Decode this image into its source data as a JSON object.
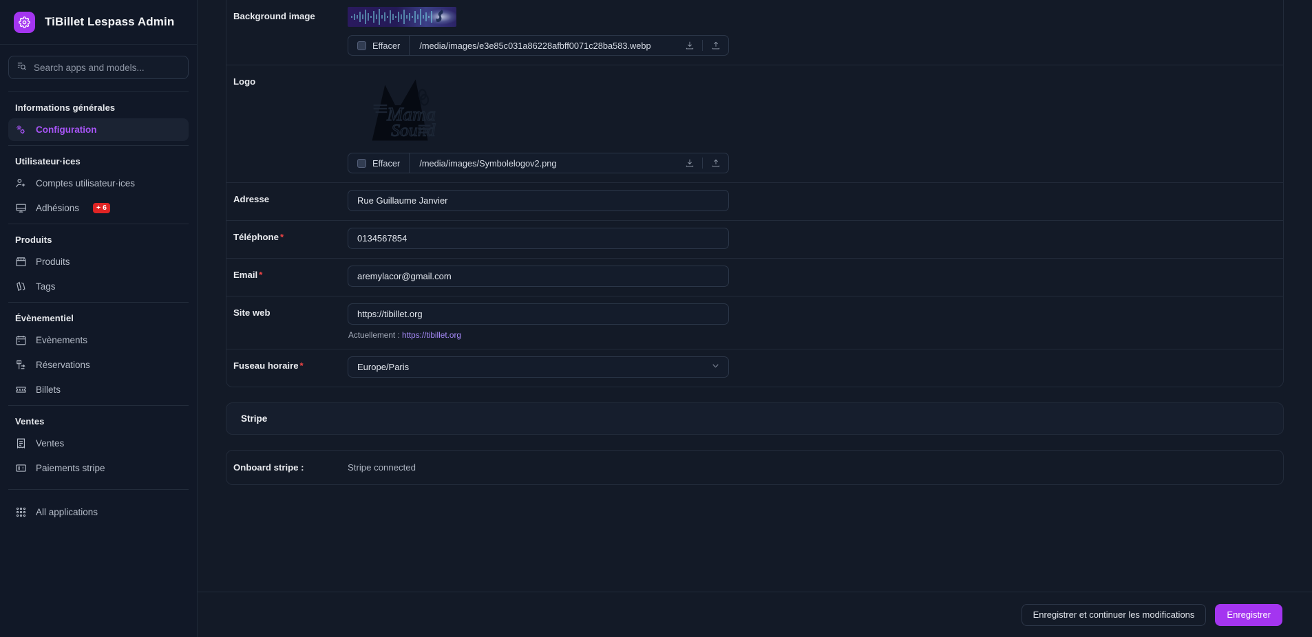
{
  "brand": {
    "title": "TiBillet Lespass Admin",
    "icon": "gear-icon",
    "accent": "#a435f0"
  },
  "search": {
    "placeholder": "Search apps and models...",
    "value": "",
    "icon": "search-list-icon"
  },
  "sidebar": {
    "groups": [
      {
        "title": "Informations générales",
        "items": [
          {
            "label": "Configuration",
            "icon": "settings-gears-icon",
            "active": true,
            "badge": ""
          }
        ]
      },
      {
        "title": "Utilisateur·ices",
        "items": [
          {
            "label": "Comptes utilisateur·ices",
            "icon": "user-add-icon",
            "active": false,
            "badge": ""
          },
          {
            "label": "Adhésions",
            "icon": "card-icon",
            "active": false,
            "badge": "+ 6"
          }
        ]
      },
      {
        "title": "Produits",
        "items": [
          {
            "label": "Produits",
            "icon": "store-icon",
            "active": false,
            "badge": ""
          },
          {
            "label": "Tags",
            "icon": "tags-icon",
            "active": false,
            "badge": ""
          }
        ]
      },
      {
        "title": "Évènementiel",
        "items": [
          {
            "label": "Evènements",
            "icon": "calendar-icon",
            "active": false,
            "badge": ""
          },
          {
            "label": "Réservations",
            "icon": "booking-icon",
            "active": false,
            "badge": ""
          },
          {
            "label": "Billets",
            "icon": "ticket-icon",
            "active": false,
            "badge": ""
          }
        ]
      },
      {
        "title": "Ventes",
        "items": [
          {
            "label": "Ventes",
            "icon": "receipt-icon",
            "active": false,
            "badge": ""
          },
          {
            "label": "Paiements stripe",
            "icon": "money-bill-icon",
            "active": false,
            "badge": ""
          }
        ]
      }
    ],
    "bottom": {
      "label": "All applications",
      "icon": "grid-apps-icon"
    },
    "badge_color": "#e02424",
    "active_color": "#a855f7"
  },
  "form": {
    "rows": [
      {
        "label": "Background image",
        "required": false,
        "type": "file",
        "preview": "audio-waveform-thumbnail",
        "clear_label": "Effacer",
        "filename": "/media/images/e3e85c031a86228afbff0071c28ba583.webp",
        "download_icon": "download-icon",
        "upload_icon": "upload-icon"
      },
      {
        "label": "Logo",
        "required": false,
        "type": "file",
        "preview": "mama-sound-logo-thumbnail",
        "clear_label": "Effacer",
        "filename": "/media/images/Symbolelogov2.png",
        "download_icon": "download-icon",
        "upload_icon": "upload-icon"
      },
      {
        "label": "Adresse",
        "required": false,
        "type": "text",
        "value": "Rue Guillaume Janvier"
      },
      {
        "label": "Téléphone",
        "required": true,
        "type": "text",
        "value": "0134567854"
      },
      {
        "label": "Email",
        "required": true,
        "type": "text",
        "value": "aremylacor@gmail.com"
      },
      {
        "label": "Site web",
        "required": false,
        "type": "text",
        "value": "https://tibillet.org",
        "hint_prefix": "Actuellement :",
        "hint_link": "https://tibillet.org"
      },
      {
        "label": "Fuseau horaire",
        "required": true,
        "type": "select",
        "value": "Europe/Paris",
        "chevron": "chevron-down-icon"
      }
    ]
  },
  "stripe": {
    "section_title": "Stripe",
    "onboard_label": "Onboard stripe :",
    "onboard_value": "Stripe connected"
  },
  "footer": {
    "save_continue_label": "Enregistrer et continuer les modifications",
    "save_label": "Enregistrer",
    "primary_color": "#a435f0"
  }
}
